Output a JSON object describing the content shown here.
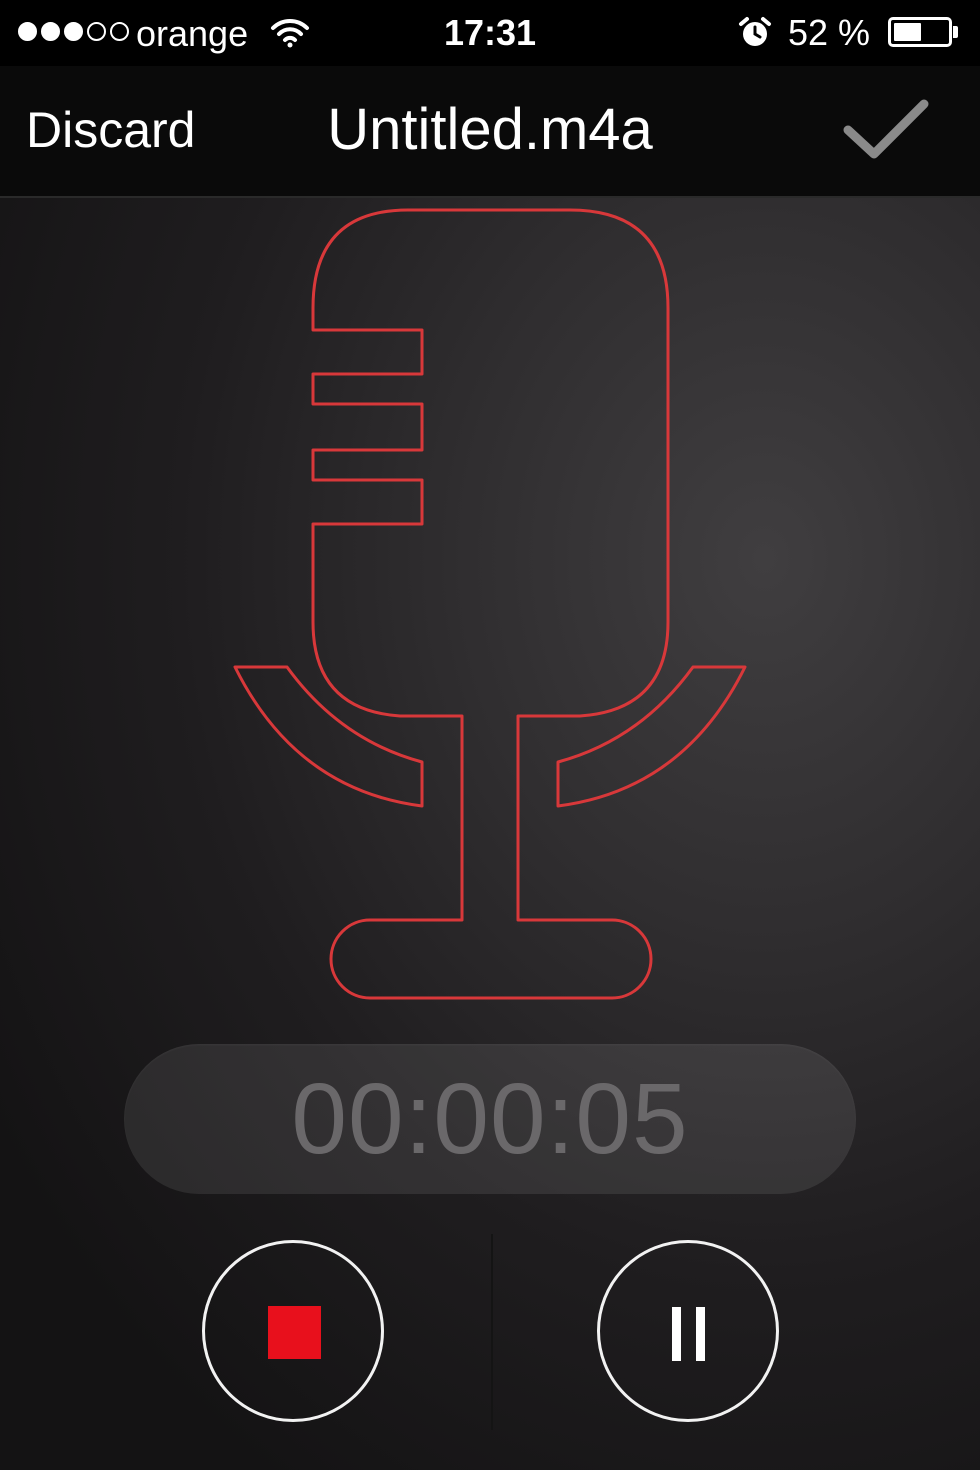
{
  "status_bar": {
    "signal_strength": 3,
    "signal_max": 5,
    "carrier": "orange",
    "time": "17:31",
    "battery_percent": "52 %",
    "battery_level": 0.52,
    "icons": [
      "wifi-icon",
      "alarm-icon",
      "battery-icon"
    ]
  },
  "nav": {
    "discard_label": "Discard",
    "title": "Untitled.m4a",
    "confirm_icon": "checkmark-icon"
  },
  "main": {
    "illustration": "microphone-outline",
    "timer": "00:00:05"
  },
  "controls": {
    "stop_icon": "stop-icon",
    "pause_icon": "pause-icon"
  },
  "colors": {
    "accent_red": "#e8101c",
    "mic_outline": "#d8383a",
    "timer_text": "#6a686a",
    "confirm_gray": "#8a8a8a"
  }
}
